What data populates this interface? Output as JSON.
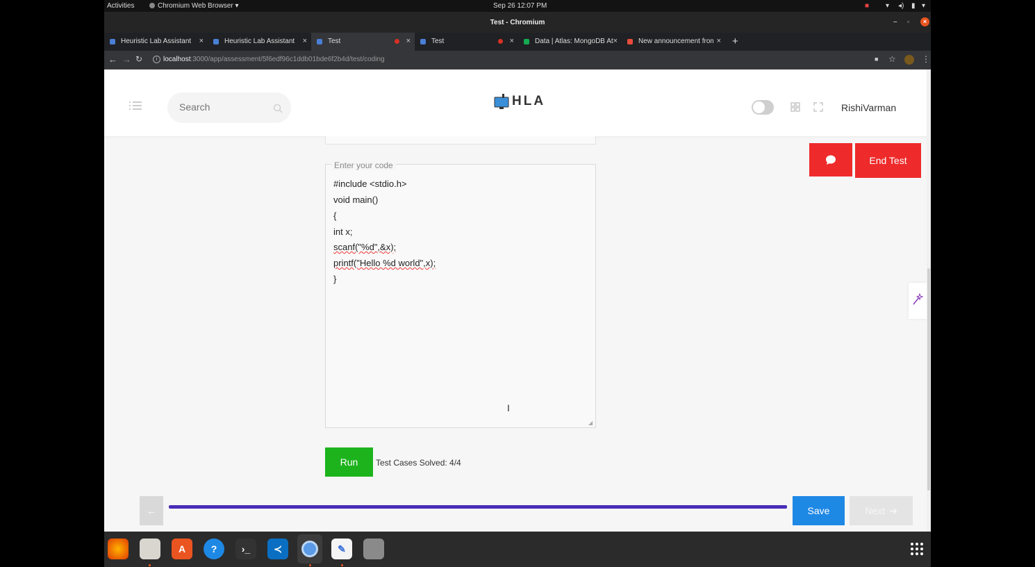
{
  "system": {
    "activities": "Activities",
    "app_menu": "Chromium Web Browser ▾",
    "clock": "Sep 26  12:07 PM"
  },
  "window": {
    "title": "Test - Chromium"
  },
  "tabs": [
    {
      "label": "Heuristic Lab Assistant",
      "favicon_color": "#4a7fd6"
    },
    {
      "label": "Heuristic Lab Assistant",
      "favicon_color": "#4a7fd6"
    },
    {
      "label": "Test",
      "favicon_color": "#4a7fd6"
    },
    {
      "label": "Test",
      "favicon_color": "#4a7fd6"
    },
    {
      "label": "Data | Atlas: MongoDB At",
      "favicon_color": "#13aa52"
    },
    {
      "label": "New announcement from",
      "favicon_color": "#e74c3c"
    }
  ],
  "address": {
    "host": "localhost",
    "path": ":3000/app/assessment/5f6edf96c1ddb01bde6f2b4d/test/coding"
  },
  "app": {
    "search_placeholder": "Search",
    "logo_text": "HLA",
    "username": "RishiVarman",
    "end_test_label": "End Test",
    "code_label": "Enter your code",
    "code_lines": [
      "#include <stdio.h>",
      "void main()",
      "{",
      "int x;",
      "scanf(\"%d\",&x);",
      "printf(\"Hello %d world\",x);",
      "}"
    ],
    "run_label": "Run",
    "result_text": "Test Cases Solved: 4/4",
    "save_label": "Save",
    "next_label": "Next",
    "progress": 1.0
  },
  "colors": {
    "run_green": "#1db31d",
    "end_red": "#ee2a2a",
    "save_blue": "#1e88e5",
    "progress_purple": "#4a2db8"
  }
}
